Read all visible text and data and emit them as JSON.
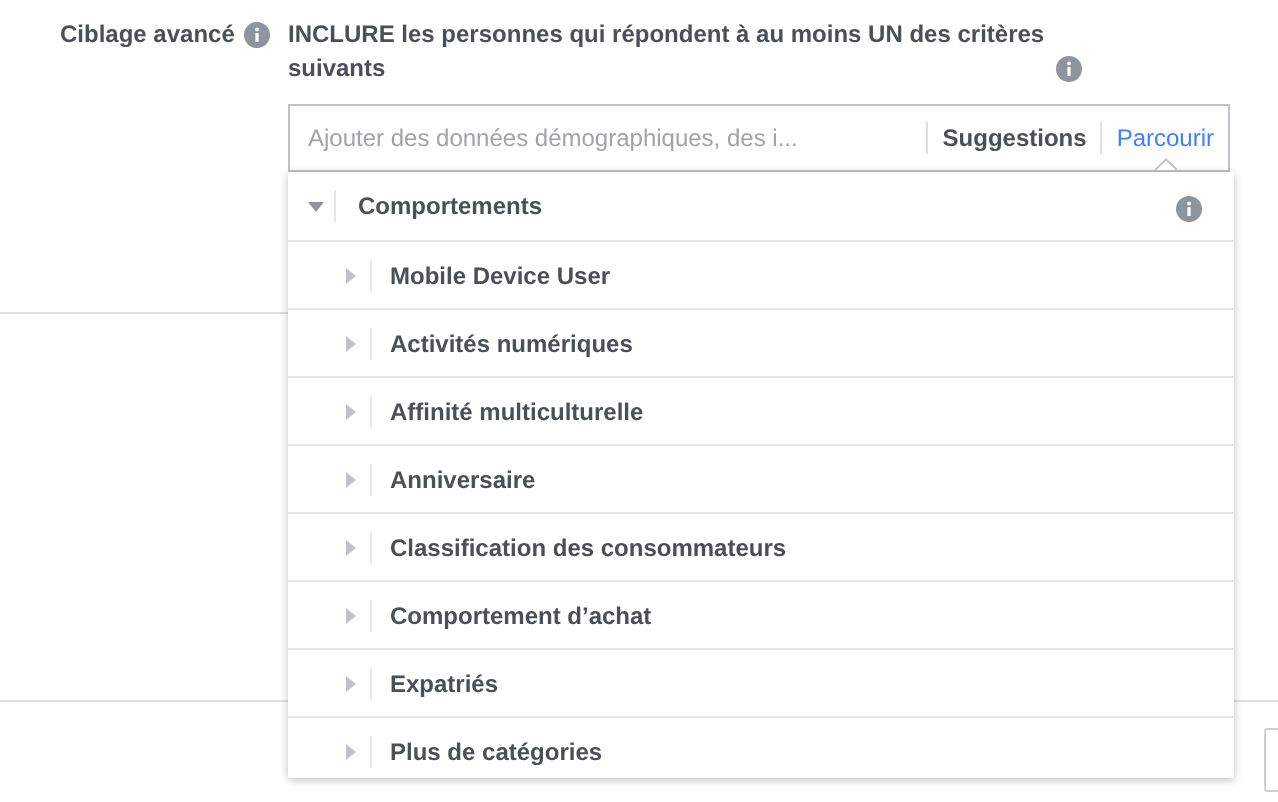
{
  "section_label": "Ciblage avancé",
  "instruction": "INCLURE les personnes qui répondent à au moins UN des critères suivants",
  "search": {
    "placeholder": "Ajouter des données démographiques, des i...",
    "tabs": [
      {
        "label": "Suggestions",
        "selected": false
      },
      {
        "label": "Parcourir",
        "selected": true
      }
    ]
  },
  "category": {
    "label": "Comportements",
    "expanded": true,
    "children": [
      {
        "label": "Mobile Device User",
        "expanded": false
      },
      {
        "label": "Activités numériques",
        "expanded": false
      },
      {
        "label": "Affinité multiculturelle",
        "expanded": false
      },
      {
        "label": "Anniversaire",
        "expanded": false
      },
      {
        "label": "Classification des consommateurs",
        "expanded": false
      },
      {
        "label": "Comportement d’achat",
        "expanded": false
      },
      {
        "label": "Expatriés",
        "expanded": false
      },
      {
        "label": "Plus de catégories",
        "expanded": false
      }
    ]
  }
}
